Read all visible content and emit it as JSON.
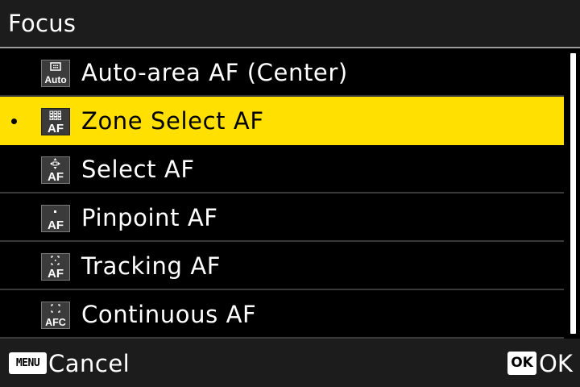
{
  "header": {
    "title": "Focus"
  },
  "items": [
    {
      "label": "Auto-area AF (Center)",
      "icon": "auto-area-af-icon",
      "icon_text": "Auto",
      "selected": false
    },
    {
      "label": "Zone Select AF",
      "icon": "zone-select-af-icon",
      "icon_text": "AF",
      "selected": true
    },
    {
      "label": "Select AF",
      "icon": "select-af-icon",
      "icon_text": "AF",
      "selected": false
    },
    {
      "label": "Pinpoint AF",
      "icon": "pinpoint-af-icon",
      "icon_text": "AF",
      "selected": false
    },
    {
      "label": "Tracking AF",
      "icon": "tracking-af-icon",
      "icon_text": "AF",
      "selected": false
    },
    {
      "label": "Continuous AF",
      "icon": "continuous-af-icon",
      "icon_text": "AFC",
      "selected": false
    }
  ],
  "footer": {
    "menu_badge": "MENU",
    "cancel_label": "Cancel",
    "ok_badge": "OK",
    "ok_label": "OK"
  },
  "colors": {
    "highlight": "#ffe000",
    "background": "#000000",
    "bar": "#1c1c1c"
  }
}
